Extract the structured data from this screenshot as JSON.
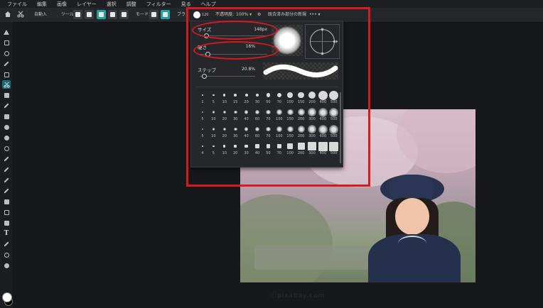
{
  "menubar": {
    "items": [
      "ファイル",
      "編集",
      "画像",
      "レイヤー",
      "選択",
      "調整",
      "フィルター",
      "見る",
      "ヘルプ"
    ]
  },
  "optionsbar": {
    "auto_select_label": "自動入",
    "tool_label": "ツール:",
    "mode_label": "モード:",
    "brush_label": "ブラ",
    "brush_size": "120",
    "opacity_label": "不透明度:",
    "opacity_value": "100%",
    "sample_label": "既合済み部分の新規",
    "more_label": "•••"
  },
  "brush_panel": {
    "size_label": "サイズ",
    "size_value": "148px",
    "hardness_label": "硬さ",
    "hardness_value": "16%",
    "step_label": "ステップ",
    "step_value": "20.8%",
    "preset_sizes_row1": [
      "1",
      "5",
      "10",
      "15",
      "20",
      "30",
      "50",
      "70",
      "100",
      "150",
      "200",
      "400",
      "500"
    ],
    "preset_sizes_row2": [
      "5",
      "10",
      "20",
      "30",
      "40",
      "60",
      "70",
      "100",
      "150",
      "200",
      "300",
      "400",
      "500"
    ],
    "preset_sizes_row3": [
      "5",
      "10",
      "20",
      "30",
      "40",
      "60",
      "70",
      "100",
      "150",
      "200",
      "300",
      "400",
      "500"
    ],
    "preset_sizes_row4": [
      "4",
      "5",
      "10",
      "20",
      "30",
      "40",
      "50",
      "70",
      "100",
      "200",
      "300",
      "400",
      "500"
    ]
  },
  "photo": {
    "caption": "ⓒpixabay.com"
  },
  "colors": {
    "accent": "#1aa3a0",
    "annotation": "#d71920",
    "foreground": "#ffffff",
    "background": "#000000"
  },
  "icons": [
    "select-icon",
    "marquee-icon",
    "lasso-icon",
    "magic-wand-icon",
    "crop-icon",
    "scissors-icon",
    "pattern-icon",
    "bandage-icon",
    "stamp-icon",
    "drop-icon",
    "dodge-icon",
    "sponge-icon",
    "pencil-icon",
    "brush-icon",
    "eraser-icon",
    "color-replace-icon",
    "bucket-icon",
    "gradient-icon",
    "shape-icon",
    "text-icon",
    "eyedropper-icon",
    "zoom-icon",
    "hand-icon"
  ]
}
